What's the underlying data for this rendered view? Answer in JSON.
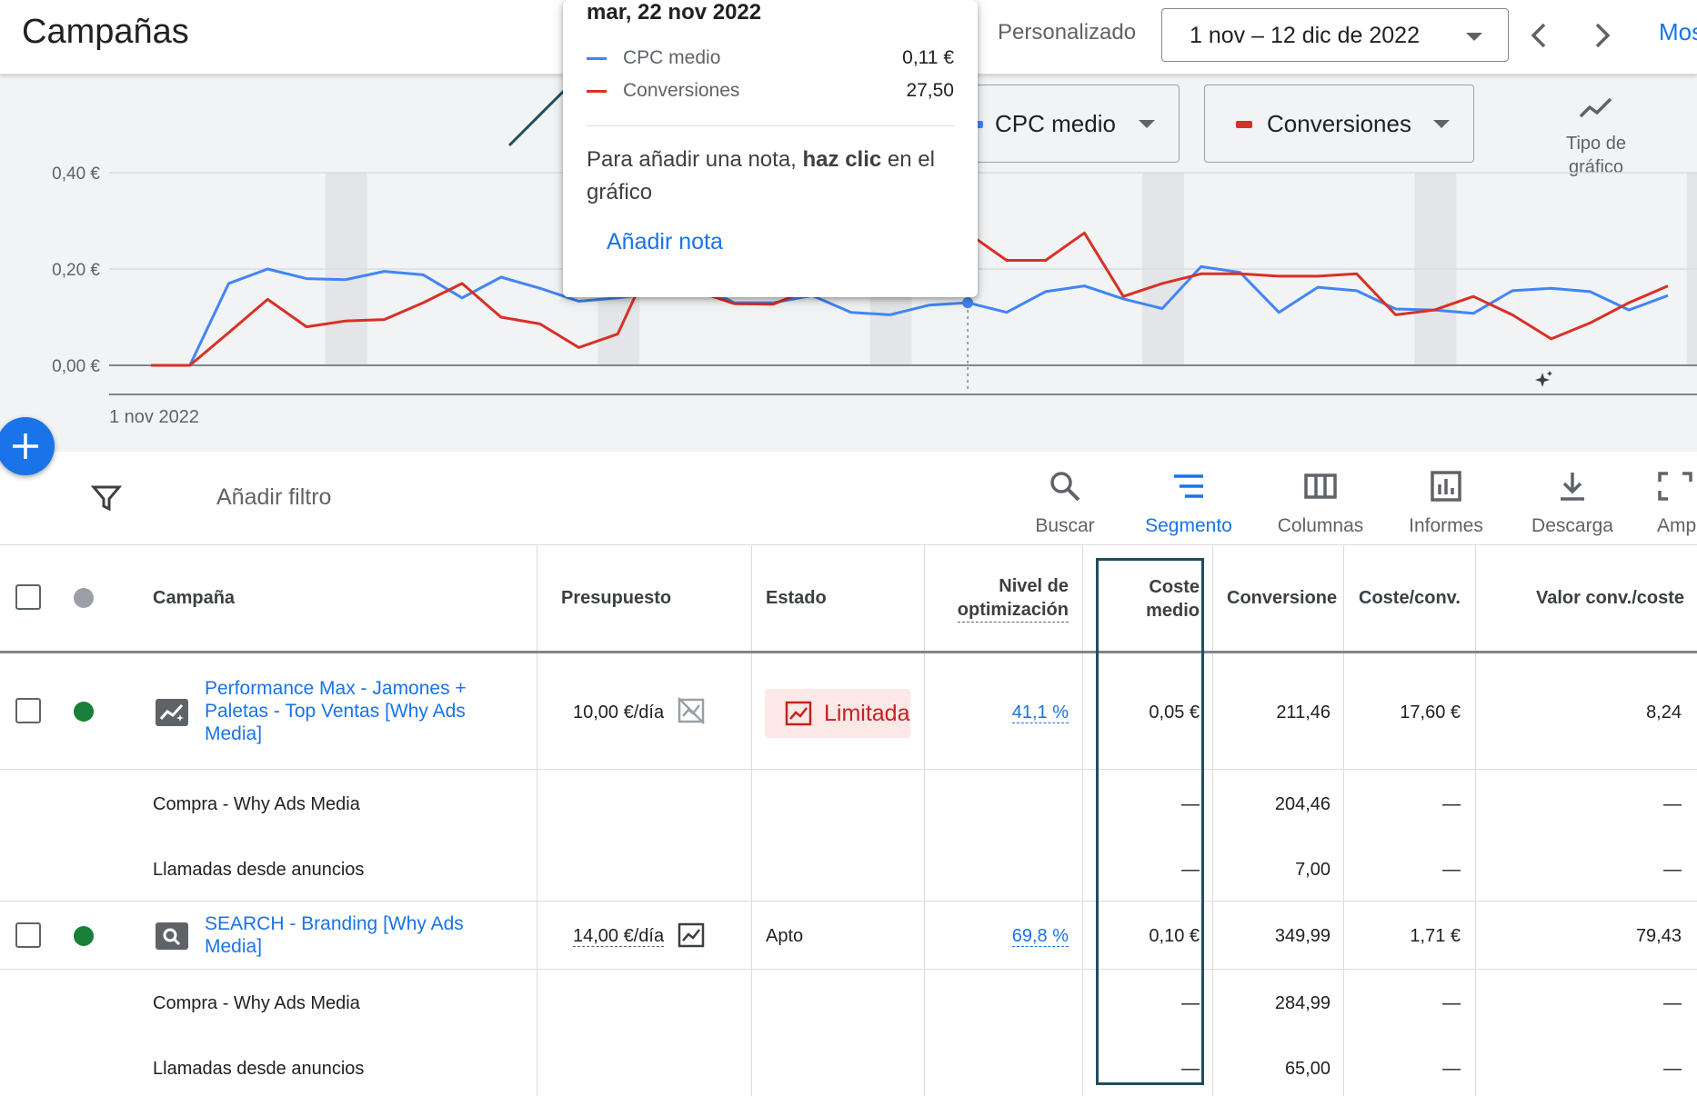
{
  "header": {
    "title": "Campañas",
    "range_label": "Personalizado",
    "date_range": "1 nov – 12 dic de 2022",
    "more_label": "Mos"
  },
  "metrics": {
    "metric1": {
      "label": "CPC medio",
      "color": "#4285f4"
    },
    "metric2": {
      "label": "Conversiones",
      "color": "#d93025"
    },
    "chart_type_label": "Tipo de gráfico"
  },
  "tooltip": {
    "date": "mar, 22 nov 2022",
    "rows": [
      {
        "name": "CPC medio",
        "value": "0,11 €",
        "color": "#4285f4"
      },
      {
        "name": "Conversiones",
        "value": "27,50",
        "color": "#d93025"
      }
    ],
    "hint_prefix": "Para añadir una nota, ",
    "hint_bold": "haz clic",
    "hint_suffix": " en el gráfico",
    "add_note": "Añadir nota"
  },
  "chart_data": {
    "type": "line",
    "x_start_label": "1 nov 2022",
    "y_ticks": [
      "0,40 €",
      "0,20 €",
      "0,00 €"
    ],
    "ylim": [
      0,
      0.4
    ],
    "series": [
      {
        "name": "CPC medio",
        "color": "#4285f4",
        "values": [
          0,
          0,
          0.17,
          0.2,
          0.18,
          0.178,
          0.195,
          0.188,
          0.14,
          0.183,
          0.16,
          0.133,
          0.14,
          0.15,
          0.17,
          0.13,
          0.13,
          0.145,
          0.11,
          0.105,
          0.125,
          0.13,
          0.11,
          0.153,
          0.165,
          0.138,
          0.118,
          0.205,
          0.193,
          0.11,
          0.162,
          0.155,
          0.117,
          0.115,
          0.108,
          0.155,
          0.16,
          0.153,
          0.115,
          0.145
        ]
      },
      {
        "name": "Conversiones",
        "color": "#d93025",
        "values": [
          0,
          0,
          0.068,
          0.137,
          0.08,
          0.092,
          0.095,
          0.13,
          0.17,
          0.1,
          0.086,
          0.037,
          0.065,
          0.24,
          0.155,
          0.128,
          0.127,
          0.16,
          0.19,
          0.25,
          0.27,
          0.275,
          0.218,
          0.218,
          0.275,
          0.143,
          0.17,
          0.19,
          0.19,
          0.185,
          0.185,
          0.19,
          0.105,
          0.115,
          0.143,
          0.105,
          0.055,
          0.088,
          0.13,
          0.165
        ]
      }
    ]
  },
  "toolbar": {
    "filter_label": "Añadir filtro",
    "tools": [
      "Buscar",
      "Segmento",
      "Columnas",
      "Informes",
      "Descarga",
      "Amp"
    ]
  },
  "table": {
    "headers": {
      "campaign": "Campaña",
      "budget": "Presupuesto",
      "status": "Estado",
      "opt_line1": "Nivel de",
      "opt_line2": "optimización",
      "cost_line1": "Coste",
      "cost_line2": "medio",
      "conversions": "Conversiones",
      "cost_conv": "Coste/conv.",
      "value_cost": "Valor conv./coste"
    },
    "rows": [
      {
        "campaign_lines": [
          "Performance Max - Jamones +",
          "Paletas - Top Ventas [Why Ads",
          "Media]"
        ],
        "budget": "10,00 €/día",
        "status": "Limitada",
        "optimization": "41,1 %",
        "avg_cost": "0,05 €",
        "conversions": "211,46",
        "cost_conv": "17,60 €",
        "value_cost": "8,24"
      },
      {
        "campaign": "Compra - Why Ads Media",
        "avg_cost": "—",
        "conversions": "204,46",
        "cost_conv": "—",
        "value_cost": "—"
      },
      {
        "campaign": "Llamadas desde anuncios",
        "avg_cost": "—",
        "conversions": "7,00",
        "cost_conv": "—",
        "value_cost": "—"
      },
      {
        "campaign_lines": [
          "SEARCH - Branding [Why Ads",
          "Media]"
        ],
        "budget": "14,00 €/día",
        "status": "Apto",
        "optimization": "69,8 %",
        "avg_cost": "0,10 €",
        "conversions": "349,99",
        "cost_conv": "1,71 €",
        "value_cost": "79,43"
      },
      {
        "campaign": "Compra - Why Ads Media",
        "avg_cost": "—",
        "conversions": "284,99",
        "cost_conv": "—",
        "value_cost": "—"
      },
      {
        "campaign": "Llamadas desde anuncios",
        "avg_cost": "—",
        "conversions": "65,00",
        "cost_conv": "—",
        "value_cost": "—"
      }
    ]
  }
}
